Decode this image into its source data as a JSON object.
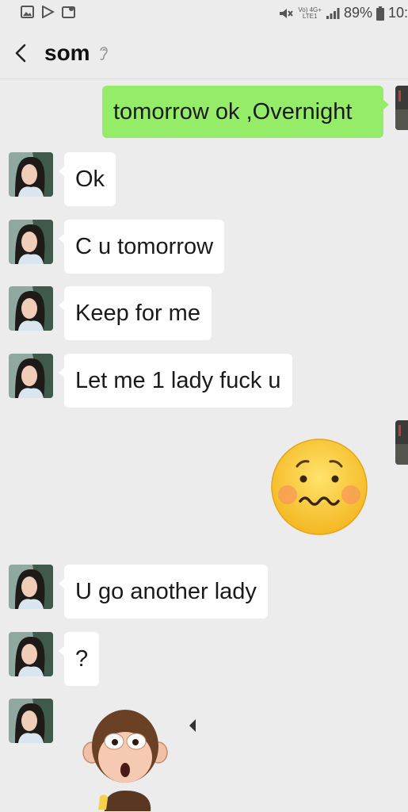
{
  "status_bar": {
    "battery": "89%",
    "time_partial": "10:",
    "network_top": "Vo) 4G+",
    "network_bottom": "LTE1"
  },
  "header": {
    "contact_name": "som"
  },
  "messages": [
    {
      "direction": "outgoing",
      "type": "text",
      "text": "tomorrow ok ,Overnight"
    },
    {
      "direction": "incoming",
      "type": "text",
      "text": "Ok"
    },
    {
      "direction": "incoming",
      "type": "text",
      "text": "C u tomorrow"
    },
    {
      "direction": "incoming",
      "type": "text",
      "text": "Keep for me"
    },
    {
      "direction": "incoming",
      "type": "text",
      "text": "Let me 1 lady fuck u"
    },
    {
      "direction": "outgoing",
      "type": "sticker",
      "icon": "worried-emoji-icon"
    },
    {
      "direction": "incoming",
      "type": "text",
      "text": "U go another lady"
    },
    {
      "direction": "incoming",
      "type": "text",
      "text": "?"
    },
    {
      "direction": "incoming",
      "type": "sticker",
      "icon": "surprised-monkey-sticker"
    }
  ],
  "colors": {
    "background": "#ececec",
    "outgoing_bubble": "#95ec69",
    "incoming_bubble": "#ffffff"
  }
}
